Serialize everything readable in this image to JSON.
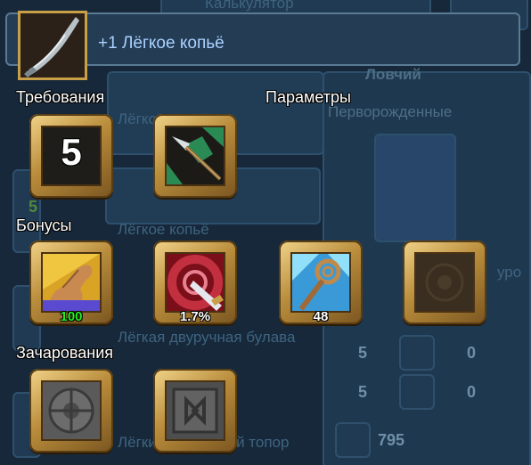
{
  "item": {
    "title": "+1 Лёгкое копьё",
    "icon": "spear-icon"
  },
  "sections": {
    "requirements": "Требования",
    "parameters": "Параметры",
    "bonuses": "Бонусы",
    "enchantments": "Зачарования"
  },
  "requirement_slots": [
    {
      "icon": "level-badge",
      "value": "5"
    }
  ],
  "parameter_slots": [
    {
      "icon": "spear-weapon-icon"
    }
  ],
  "bonus_slots": [
    {
      "icon": "strength-arm-icon",
      "value": "100",
      "value_color": "#22ee22"
    },
    {
      "icon": "crit-blade-icon",
      "value": "1.7%",
      "value_color": "#ffffff"
    },
    {
      "icon": "magic-staff-icon",
      "value": "48",
      "value_color": "#ffffff"
    },
    {
      "icon": "empty-slot-icon",
      "value": ""
    }
  ],
  "enchantment_slots": [
    {
      "icon": "stone-rune-round-icon"
    },
    {
      "icon": "stone-rune-angular-icon"
    }
  ],
  "background": {
    "top_title": "Калькулятор",
    "class_name": "Ловчий",
    "race_name": "Перворожденные",
    "list_items": [
      "Лёгкое копьё",
      "Лёгкое копьё",
      "Лёгкая двуручная булава",
      "Лёгкий двуручный топор"
    ],
    "level_marker": "5",
    "stat_rows": [
      {
        "left": "5",
        "right": "0"
      },
      {
        "left": "5",
        "right": "0"
      }
    ],
    "health": "795",
    "partial_label": "уро"
  }
}
